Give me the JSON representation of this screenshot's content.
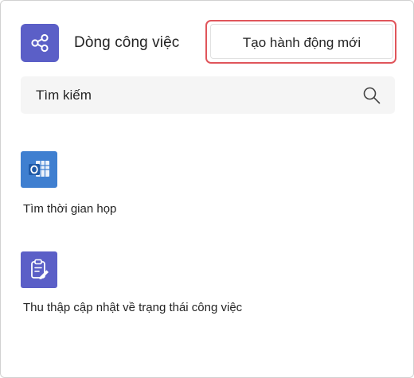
{
  "header": {
    "app_title": "Dòng công việc",
    "new_action_label": "Tạo hành động mới"
  },
  "search": {
    "placeholder": "Tìm kiếm"
  },
  "actions": [
    {
      "label": "Tìm thời gian họp",
      "icon": "outlook-calendar-icon",
      "color": "#3f7fd0"
    },
    {
      "label": "Thu thập cập nhật về trạng thái công việc",
      "icon": "clipboard-edit-icon",
      "color": "#5b5fc7"
    }
  ],
  "colors": {
    "accent": "#5b5fc7",
    "highlight_outline": "#e0555b",
    "search_background": "#f5f5f5"
  }
}
